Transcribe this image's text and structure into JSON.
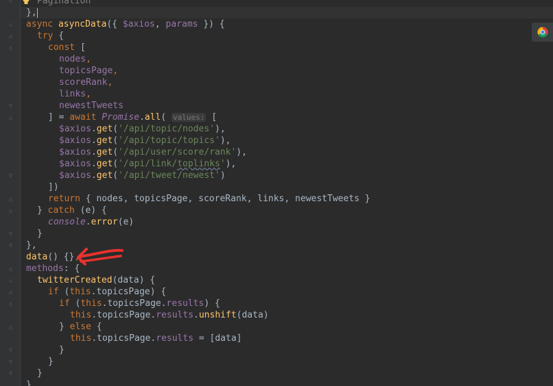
{
  "editor": {
    "lines": [
      {
        "indent": 1,
        "tokens": [
          [
            "c",
            "Pagination"
          ]
        ]
      },
      {
        "indent": 0,
        "tokens": [
          [
            "t",
            "},"
          ],
          [
            "caret",
            ""
          ]
        ]
      },
      {
        "indent": 0,
        "tokens": [
          [
            "k",
            "async "
          ],
          [
            "f",
            "asyncData"
          ],
          [
            "t",
            "({ "
          ],
          [
            "p",
            "$axios"
          ],
          [
            "t",
            ", "
          ],
          [
            "p",
            "params"
          ],
          [
            "t",
            " }) {"
          ]
        ]
      },
      {
        "indent": 1,
        "tokens": [
          [
            "k",
            "try"
          ],
          [
            "t",
            " {"
          ]
        ]
      },
      {
        "indent": 2,
        "tokens": [
          [
            "k",
            "const"
          ],
          [
            "t",
            " ["
          ]
        ]
      },
      {
        "indent": 3,
        "tokens": [
          [
            "p",
            "nodes"
          ],
          [
            "k",
            ","
          ]
        ]
      },
      {
        "indent": 3,
        "tokens": [
          [
            "p",
            "topicsPage"
          ],
          [
            "k",
            ","
          ]
        ]
      },
      {
        "indent": 3,
        "tokens": [
          [
            "p",
            "scoreRank"
          ],
          [
            "k",
            ","
          ]
        ]
      },
      {
        "indent": 3,
        "tokens": [
          [
            "p",
            "links"
          ],
          [
            "k",
            ","
          ]
        ]
      },
      {
        "indent": 3,
        "tokens": [
          [
            "p",
            "newestTweets"
          ]
        ]
      },
      {
        "indent": 2,
        "tokens": [
          [
            "t",
            "] = "
          ],
          [
            "k",
            "await "
          ],
          [
            "g",
            "Promise"
          ],
          [
            "t",
            "."
          ],
          [
            "m",
            "all"
          ],
          [
            "t",
            "( "
          ],
          [
            "hint",
            "values:"
          ],
          [
            "t",
            " ["
          ]
        ]
      },
      {
        "indent": 3,
        "tokens": [
          [
            "p",
            "$axios"
          ],
          [
            "t",
            "."
          ],
          [
            "m",
            "get"
          ],
          [
            "t",
            "("
          ],
          [
            "s",
            "'/api/topic/nodes'"
          ],
          [
            "t",
            "),"
          ]
        ]
      },
      {
        "indent": 3,
        "tokens": [
          [
            "p",
            "$axios"
          ],
          [
            "t",
            "."
          ],
          [
            "m",
            "get"
          ],
          [
            "t",
            "("
          ],
          [
            "s",
            "'/api/topic/topics'"
          ],
          [
            "t",
            "),"
          ]
        ]
      },
      {
        "indent": 3,
        "tokens": [
          [
            "p",
            "$axios"
          ],
          [
            "t",
            "."
          ],
          [
            "m",
            "get"
          ],
          [
            "t",
            "("
          ],
          [
            "s",
            "'/api/user/score/rank'"
          ],
          [
            "t",
            "),"
          ]
        ]
      },
      {
        "indent": 3,
        "tokens": [
          [
            "p",
            "$axios"
          ],
          [
            "t",
            "."
          ],
          [
            "m",
            "get"
          ],
          [
            "t",
            "("
          ],
          [
            "s",
            "'/api/link/"
          ],
          [
            "su",
            "toplinks"
          ],
          [
            "s",
            "'"
          ],
          [
            "t",
            "),"
          ]
        ]
      },
      {
        "indent": 3,
        "tokens": [
          [
            "p",
            "$axios"
          ],
          [
            "t",
            "."
          ],
          [
            "m",
            "get"
          ],
          [
            "t",
            "("
          ],
          [
            "s",
            "'/api/tweet/newest'"
          ],
          [
            "t",
            ")"
          ]
        ]
      },
      {
        "indent": 2,
        "tokens": [
          [
            "t",
            "])"
          ]
        ]
      },
      {
        "indent": 2,
        "tokens": [
          [
            "k",
            "return"
          ],
          [
            "t",
            " { nodes, topicsPage, scoreRank, links, newestTweets }"
          ]
        ]
      },
      {
        "indent": 1,
        "tokens": [
          [
            "t",
            "} "
          ],
          [
            "k",
            "catch"
          ],
          [
            "t",
            " (e) {"
          ]
        ]
      },
      {
        "indent": 2,
        "tokens": [
          [
            "g",
            "console"
          ],
          [
            "t",
            "."
          ],
          [
            "m",
            "error"
          ],
          [
            "t",
            "(e)"
          ]
        ]
      },
      {
        "indent": 1,
        "tokens": [
          [
            "t",
            "}"
          ]
        ]
      },
      {
        "indent": 0,
        "tokens": [
          [
            "t",
            "},"
          ]
        ]
      },
      {
        "indent": 0,
        "tokens": [
          [
            "f",
            "data"
          ],
          [
            "t",
            "() {}"
          ],
          [
            "k",
            ","
          ]
        ]
      },
      {
        "indent": 0,
        "tokens": [
          [
            "p",
            "methods"
          ],
          [
            "t",
            ": {"
          ]
        ]
      },
      {
        "indent": 1,
        "tokens": [
          [
            "f",
            "twitterCreated"
          ],
          [
            "t",
            "(data) {"
          ]
        ]
      },
      {
        "indent": 2,
        "tokens": [
          [
            "k",
            "if"
          ],
          [
            "t",
            " ("
          ],
          [
            "k",
            "this"
          ],
          [
            "t",
            ".topicsPage) {"
          ]
        ]
      },
      {
        "indent": 3,
        "tokens": [
          [
            "k",
            "if"
          ],
          [
            "t",
            " ("
          ],
          [
            "k",
            "this"
          ],
          [
            "t",
            ".topicsPage."
          ],
          [
            "p",
            "results"
          ],
          [
            "t",
            ") {"
          ]
        ]
      },
      {
        "indent": 4,
        "tokens": [
          [
            "k",
            "this"
          ],
          [
            "t",
            ".topicsPage."
          ],
          [
            "p",
            "results"
          ],
          [
            "t",
            "."
          ],
          [
            "m",
            "unshift"
          ],
          [
            "t",
            "(data)"
          ]
        ]
      },
      {
        "indent": 3,
        "tokens": [
          [
            "t",
            "} "
          ],
          [
            "k",
            "else"
          ],
          [
            "t",
            " {"
          ]
        ]
      },
      {
        "indent": 4,
        "tokens": [
          [
            "k",
            "this"
          ],
          [
            "t",
            ".topicsPage."
          ],
          [
            "p",
            "results"
          ],
          [
            "t",
            " = [data]"
          ]
        ]
      },
      {
        "indent": 3,
        "tokens": [
          [
            "t",
            "}"
          ]
        ]
      },
      {
        "indent": 2,
        "tokens": [
          [
            "t",
            "}"
          ]
        ]
      },
      {
        "indent": 1,
        "tokens": [
          [
            "t",
            "}"
          ]
        ]
      },
      {
        "indent": 0,
        "tokens": [
          [
            "t",
            "},"
          ]
        ]
      }
    ],
    "folds": [
      {
        "line": 0,
        "kind": "close"
      },
      {
        "line": 2,
        "kind": "open"
      },
      {
        "line": 3,
        "kind": "open"
      },
      {
        "line": 4,
        "kind": "open"
      },
      {
        "line": 9,
        "kind": "close"
      },
      {
        "line": 10,
        "kind": "open"
      },
      {
        "line": 15,
        "kind": "close"
      },
      {
        "line": 17,
        "kind": "open"
      },
      {
        "line": 18,
        "kind": "open"
      },
      {
        "line": 20,
        "kind": "close"
      },
      {
        "line": 21,
        "kind": "close"
      },
      {
        "line": 23,
        "kind": "open"
      },
      {
        "line": 24,
        "kind": "open"
      },
      {
        "line": 25,
        "kind": "open"
      },
      {
        "line": 26,
        "kind": "open"
      },
      {
        "line": 28,
        "kind": "open"
      },
      {
        "line": 30,
        "kind": "close"
      },
      {
        "line": 31,
        "kind": "close"
      },
      {
        "line": 32,
        "kind": "close"
      }
    ]
  },
  "colors": {
    "background": "#2b2b2b",
    "keyword": "#cc7832",
    "function": "#ffc66d",
    "property": "#9876aa",
    "string": "#6a8759",
    "text": "#a9b7c6",
    "annotation_arrow": "#e8322e"
  },
  "icons": {
    "intention_bulb": "lightbulb-icon",
    "browser_preview": "chrome-icon",
    "annotation": "red-arrow"
  }
}
